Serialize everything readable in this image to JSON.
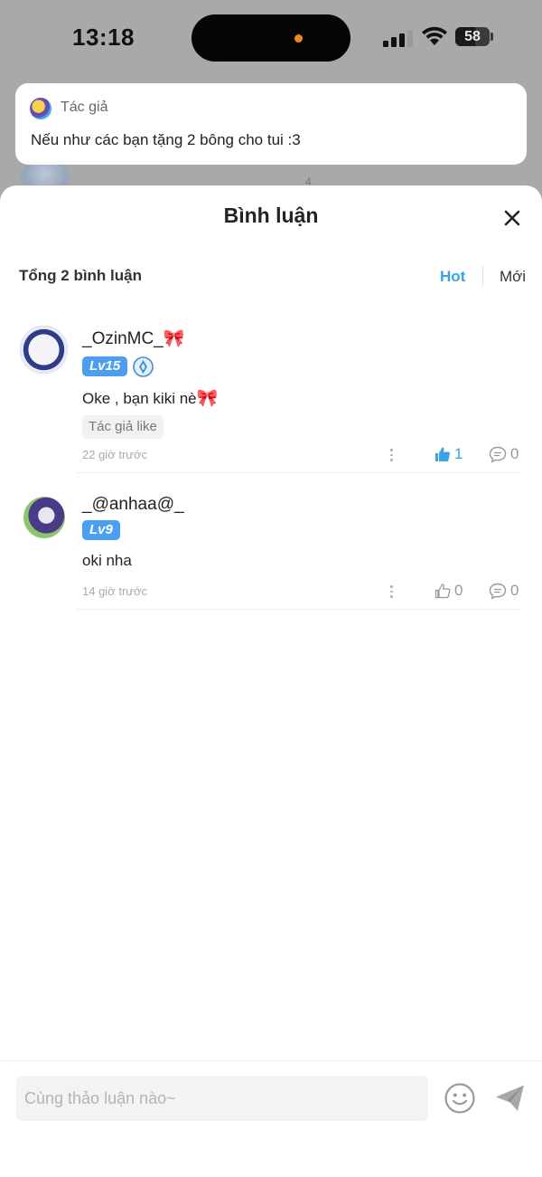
{
  "status_bar": {
    "time": "13:18",
    "battery": "58",
    "battery_level": 0.58
  },
  "background": {
    "peek_count": "4"
  },
  "notification": {
    "author": "Tác giả",
    "message": "Nếu như các bạn tặng 2 bông cho tui :3"
  },
  "sheet": {
    "title": "Bình luận",
    "total_label": "Tổng 2 bình luận",
    "sort": {
      "hot": "Hot",
      "new": "Mới",
      "active": "Hot"
    },
    "accent_color": "#3aa3e6"
  },
  "comments": [
    {
      "username": "_OzinMC_",
      "emoji": "🎀",
      "level": "Lv15",
      "has_medal": true,
      "text": "Oke , bạn kiki nè",
      "text_emoji": "🎀",
      "author_like_tag": "Tác giả like",
      "time_ago": "22 giờ trước",
      "likes": "1",
      "liked": true,
      "replies": "0"
    },
    {
      "username": "_@anhaa@_",
      "level": "Lv9",
      "has_medal": false,
      "text": "oki nha",
      "time_ago": "14 giờ trước",
      "likes": "0",
      "liked": false,
      "replies": "0"
    }
  ],
  "input": {
    "placeholder": "Cùng thảo luận nào~",
    "value": ""
  },
  "icons": {
    "close": "close-icon",
    "emoji": "smiley-icon",
    "send": "send-icon",
    "like": "thumbs-up-icon",
    "reply": "comment-bubble-icon",
    "more": "more-vertical-icon"
  }
}
